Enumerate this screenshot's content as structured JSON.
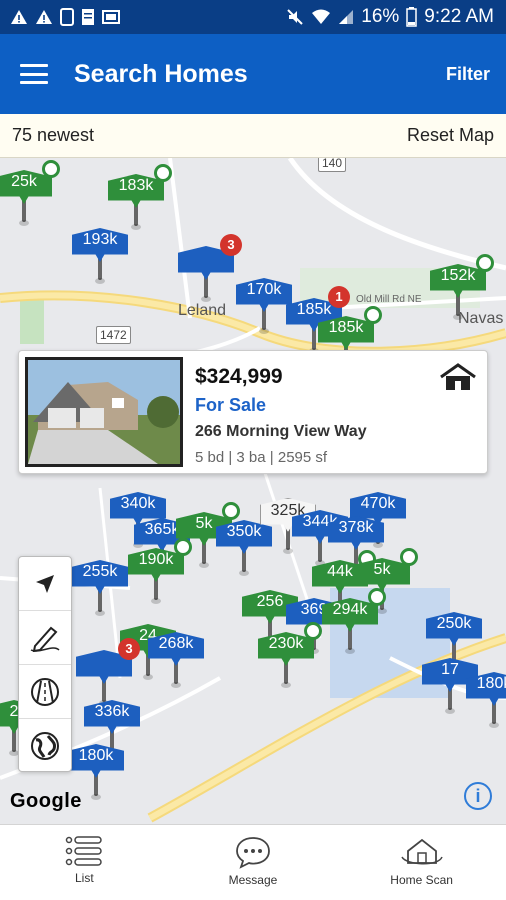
{
  "status_bar": {
    "left_icons": [
      "warning-icon",
      "warning-icon",
      "phone-icon",
      "document-icon",
      "image-icon"
    ],
    "right_icons": [
      "mute-icon",
      "wifi-icon",
      "signal-icon",
      "battery-icon"
    ],
    "battery": "16%",
    "time": "9:22 AM"
  },
  "app_bar": {
    "menu_icon": "hamburger-icon",
    "title": "Search Homes",
    "filter_label": "Filter"
  },
  "subbar": {
    "count_label": "75 newest",
    "reset_label": "Reset Map"
  },
  "map": {
    "place_labels": [
      "Leland",
      "Navas",
      "Old Mill Rd NE",
      "1472",
      "140"
    ],
    "markers": [
      {
        "label": "25k",
        "color": "green",
        "indicator": "dot"
      },
      {
        "label": "183k",
        "color": "green",
        "indicator": "dot"
      },
      {
        "label": "193k",
        "color": "blue",
        "indicator": ""
      },
      {
        "label": "",
        "color": "blue",
        "indicator": "count",
        "count": "3"
      },
      {
        "label": "170k",
        "color": "blue",
        "indicator": ""
      },
      {
        "label": "185k",
        "color": "blue",
        "indicator": "count",
        "count": "1"
      },
      {
        "label": "185k",
        "color": "green",
        "indicator": "dot"
      },
      {
        "label": "152k",
        "color": "green",
        "indicator": "dot"
      },
      {
        "label": "340k",
        "color": "blue",
        "indicator": ""
      },
      {
        "label": "365k",
        "color": "blue",
        "indicator": ""
      },
      {
        "label": "5k",
        "color": "green",
        "indicator": "dot"
      },
      {
        "label": "350k",
        "color": "blue",
        "indicator": ""
      },
      {
        "label": "325k",
        "color": "white",
        "indicator": ""
      },
      {
        "label": "344k",
        "color": "blue",
        "indicator": ""
      },
      {
        "label": "470k",
        "color": "blue",
        "indicator": ""
      },
      {
        "label": "378k",
        "color": "blue",
        "indicator": ""
      },
      {
        "label": "255k",
        "color": "blue",
        "indicator": ""
      },
      {
        "label": "190k",
        "color": "green",
        "indicator": "dot"
      },
      {
        "label": "44k",
        "color": "green",
        "indicator": "dot"
      },
      {
        "label": "5k",
        "color": "green",
        "indicator": "dot"
      },
      {
        "label": "256",
        "color": "green",
        "indicator": ""
      },
      {
        "label": "369",
        "color": "blue",
        "indicator": ""
      },
      {
        "label": "294k",
        "color": "green",
        "indicator": "dot"
      },
      {
        "label": "250k",
        "color": "blue",
        "indicator": ""
      },
      {
        "label": "24",
        "color": "green",
        "indicator": ""
      },
      {
        "label": "268k",
        "color": "blue",
        "indicator": ""
      },
      {
        "label": "230k",
        "color": "green",
        "indicator": "dot"
      },
      {
        "label": "",
        "color": "blue",
        "indicator": "count",
        "count": "3"
      },
      {
        "label": "17",
        "color": "blue",
        "indicator": ""
      },
      {
        "label": "180k",
        "color": "blue",
        "indicator": ""
      },
      {
        "label": "336k",
        "color": "blue",
        "indicator": ""
      },
      {
        "label": "180k",
        "color": "blue",
        "indicator": ""
      },
      {
        "label": "2",
        "color": "green",
        "indicator": ""
      }
    ]
  },
  "callout": {
    "price": "$324,999",
    "status": "For Sale",
    "address": "266 Morning View Way",
    "details": "5 bd | 3 ba | 2595 sf",
    "type_icon": "house-icon"
  },
  "map_tools": [
    {
      "name": "locate-icon"
    },
    {
      "name": "draw-icon"
    },
    {
      "name": "road-view-icon"
    },
    {
      "name": "globe-icon"
    }
  ],
  "attribution": {
    "google": "Google",
    "info": "i"
  },
  "bottom_nav": [
    {
      "label": "List",
      "icon": "list-icon"
    },
    {
      "label": "Message",
      "icon": "message-icon"
    },
    {
      "label": "Home Scan",
      "icon": "home-scan-icon"
    }
  ],
  "colors": {
    "status_bar": "#0a3e86",
    "app_bar": "#0d5fc4",
    "marker_blue": "#1d5fbf",
    "marker_green": "#2f8f3b",
    "status_link": "#1d63c8",
    "count_badge": "#d3342c"
  }
}
